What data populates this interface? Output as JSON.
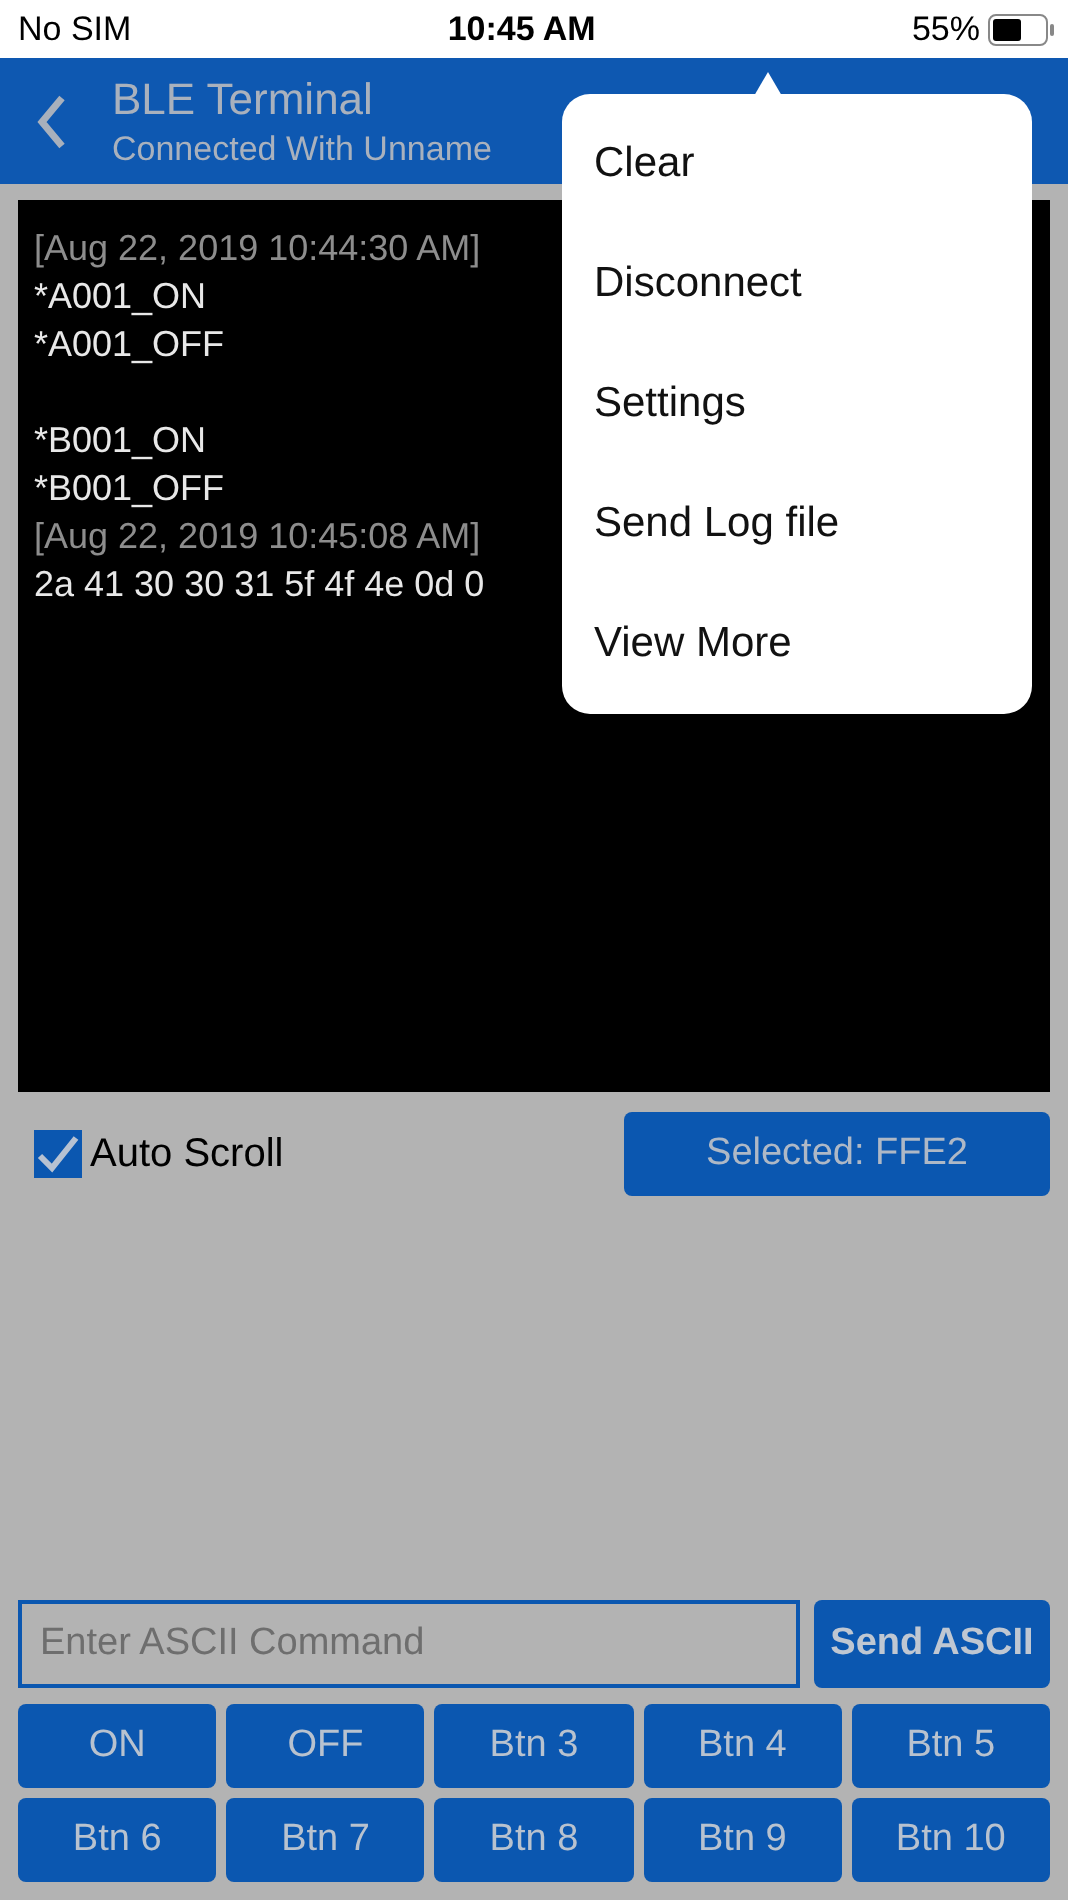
{
  "status_bar": {
    "carrier": "No SIM",
    "time": "10:45 AM",
    "battery": "55%"
  },
  "nav": {
    "title": "BLE Terminal",
    "subtitle": "Connected With Unname"
  },
  "terminal": {
    "lines": [
      {
        "kind": "timestamp",
        "text": "[Aug 22, 2019 10:44:30 AM]"
      },
      {
        "kind": "data",
        "text": "*A001_ON"
      },
      {
        "kind": "data",
        "text": "*A001_OFF"
      },
      {
        "kind": "blank"
      },
      {
        "kind": "data",
        "text": "*B001_ON"
      },
      {
        "kind": "data",
        "text": "*B001_OFF"
      },
      {
        "kind": "timestamp",
        "text": "[Aug 22, 2019 10:45:08 AM]"
      },
      {
        "kind": "data",
        "text": "2a 41 30 30 31 5f 4f 4e 0d 0"
      }
    ]
  },
  "auto_scroll": {
    "label": "Auto Scroll",
    "checked": true
  },
  "selected_button": "Selected: FFE2",
  "command": {
    "placeholder": "Enter ASCII Command",
    "send": "Send ASCII"
  },
  "buttons": [
    "ON",
    "OFF",
    "Btn 3",
    "Btn 4",
    "Btn 5",
    "Btn 6",
    "Btn 7",
    "Btn 8",
    "Btn 9",
    "Btn 10"
  ],
  "menu": {
    "items": [
      "Clear",
      "Disconnect",
      "Settings",
      "Send Log file",
      "View More"
    ]
  }
}
